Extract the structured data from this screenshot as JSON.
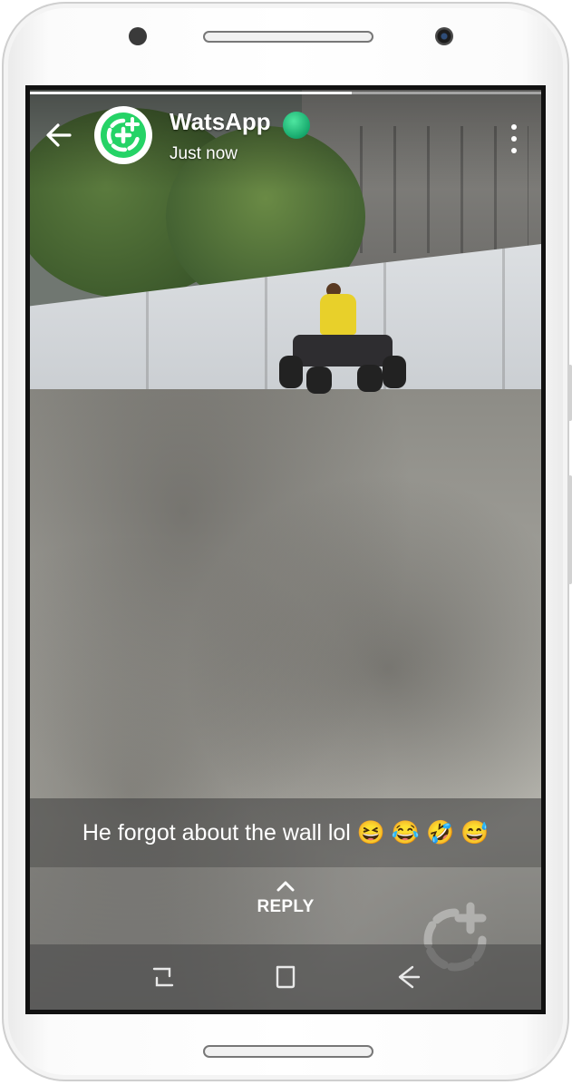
{
  "status": {
    "contact_name": "WatsApp",
    "timestamp": "Just now",
    "progress": 0.63,
    "caption": "He forgot about the wall lol 😆 😂 🤣 😅",
    "reply_label": "REPLY"
  },
  "icons": {
    "back": "arrow-left-icon",
    "avatar": "status-plus-icon",
    "online": "online-dot",
    "menu": "more-vert-icon",
    "reply": "chevron-up-icon",
    "watermark": "status-plus-icon",
    "nav_recent": "recent-apps-icon",
    "nav_home": "home-icon",
    "nav_back": "back-icon"
  },
  "colors": {
    "accent": "#25D366",
    "online": "#16a86c"
  }
}
